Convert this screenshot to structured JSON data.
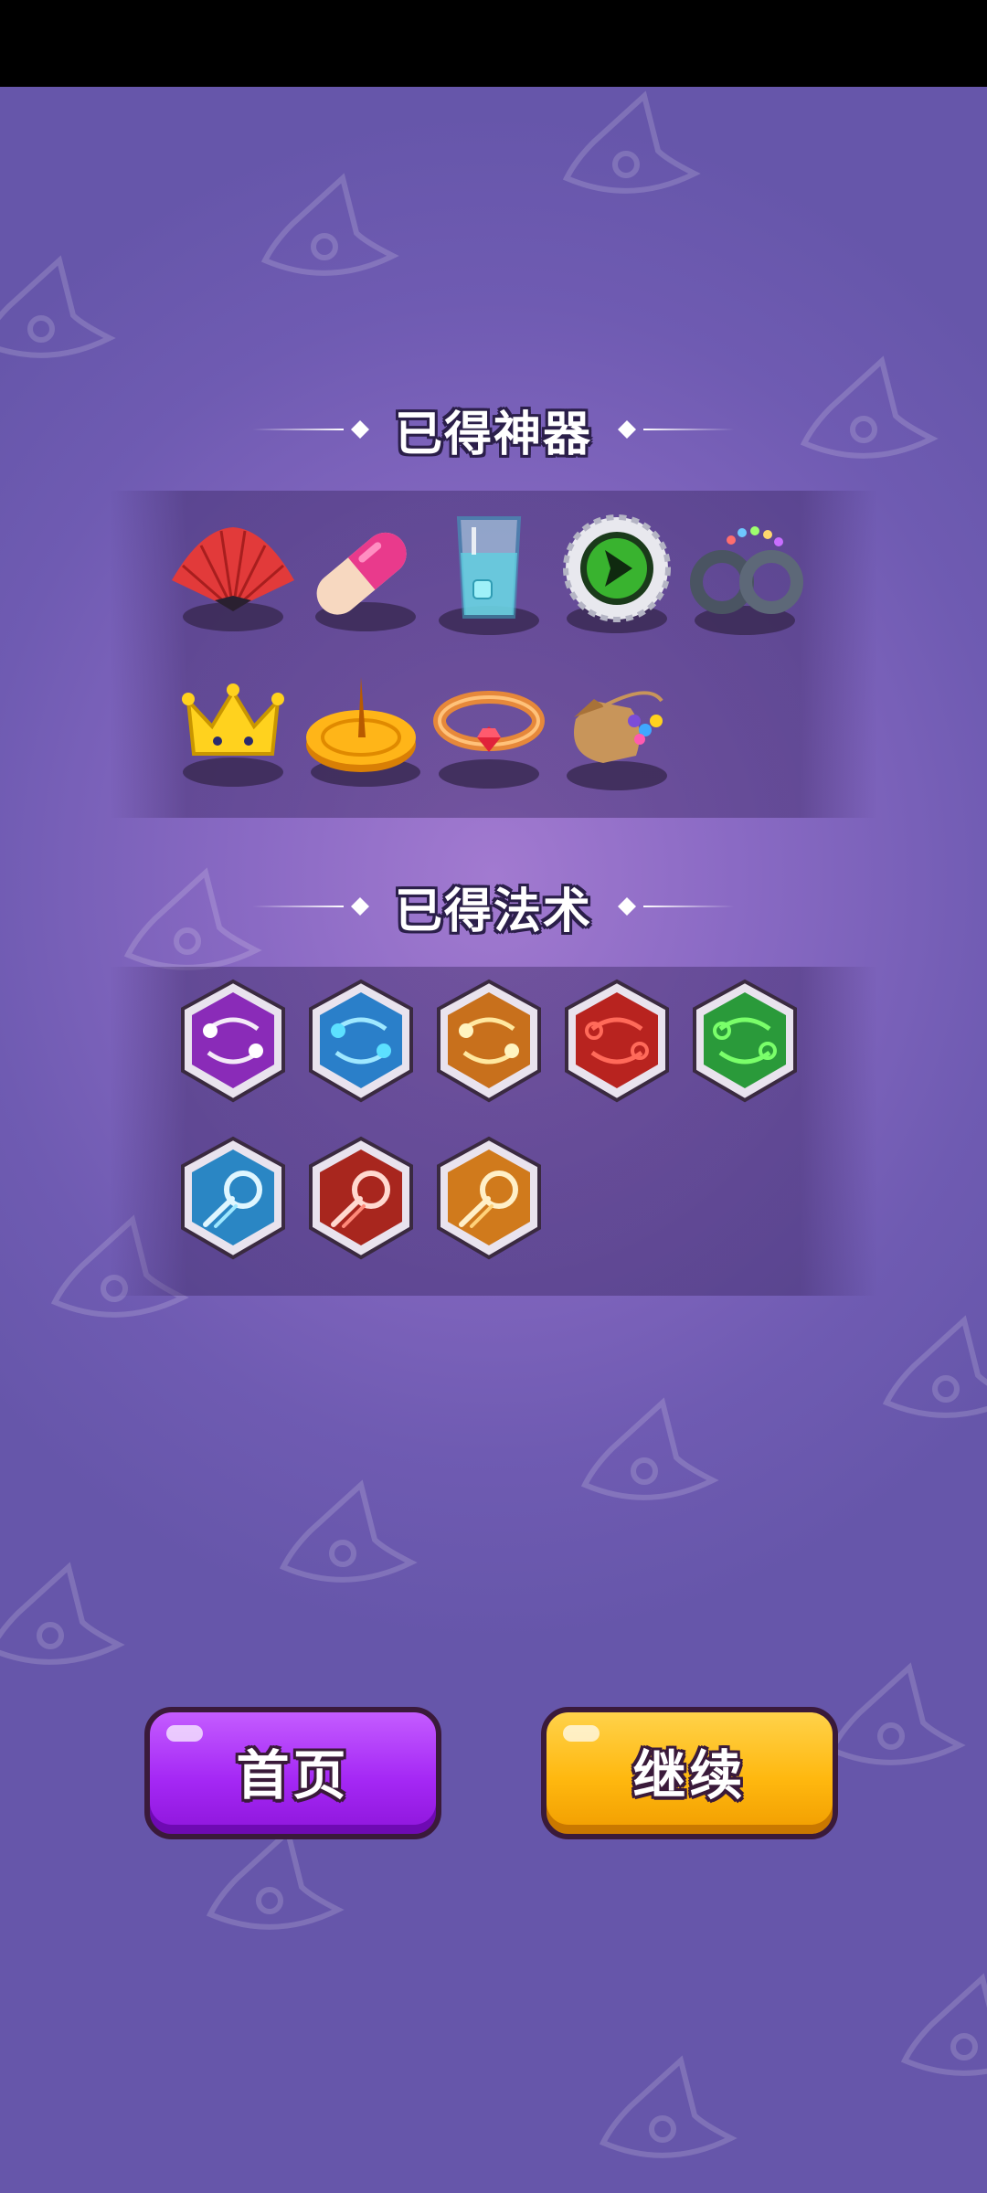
{
  "artifacts_section": {
    "title": "已得神器"
  },
  "spells_section": {
    "title": "已得法术"
  },
  "artifacts": [
    {
      "icon": "red-folding-fan-icon"
    },
    {
      "icon": "pink-pill-capsule-icon"
    },
    {
      "icon": "water-glass-icon"
    },
    {
      "icon": "green-gear-emblem-icon"
    },
    {
      "icon": "handcuffs-with-gems-icon"
    },
    {
      "icon": "golden-crown-icon"
    },
    {
      "icon": "sundial-icon"
    },
    {
      "icon": "ruby-ring-icon"
    },
    {
      "icon": "gem-pouch-icon"
    }
  ],
  "spells": [
    {
      "icon": "purple-orbit-spell-icon",
      "color": "#8a2bb8"
    },
    {
      "icon": "blue-orbit-spell-icon",
      "color": "#2a7fc9"
    },
    {
      "icon": "orange-orbit-spell-icon",
      "color": "#c8701c"
    },
    {
      "icon": "red-orbit-spell-icon",
      "color": "#b8231f"
    },
    {
      "icon": "green-orbit-spell-icon",
      "color": "#2a9a3a"
    },
    {
      "icon": "blue-comet-spell-icon",
      "color": "#2a86c4"
    },
    {
      "icon": "red-comet-spell-icon",
      "color": "#a8261e"
    },
    {
      "icon": "orange-comet-spell-icon",
      "color": "#d07a1c"
    }
  ],
  "buttons": {
    "home_label": "首页",
    "continue_label": "继续"
  },
  "colors": {
    "home_button": "#a528f5",
    "continue_button": "#ffb80f",
    "background": "#7a63b8"
  }
}
